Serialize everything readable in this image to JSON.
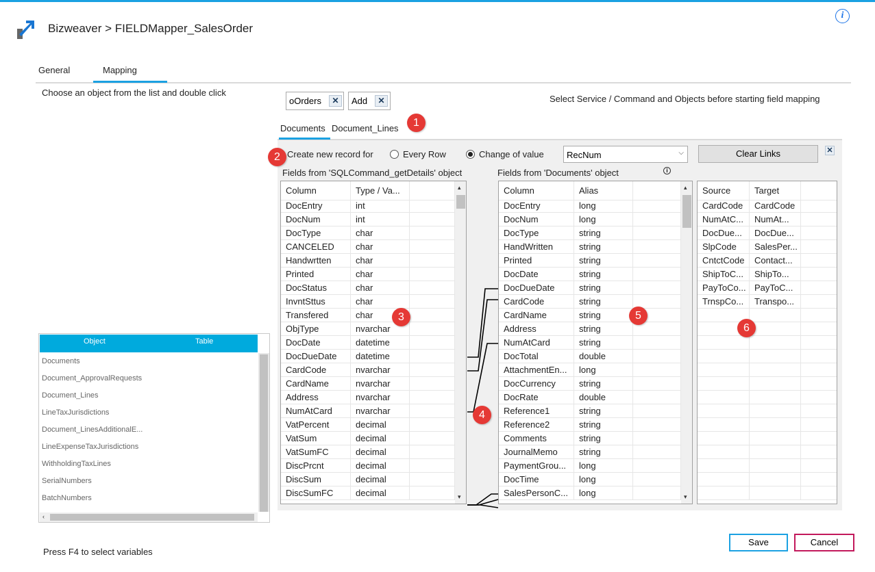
{
  "window": {
    "breadcrumb": "Bizweaver > FIELDMapper_SalesOrder",
    "info_glyph": "i"
  },
  "tabs": [
    {
      "label": "General"
    },
    {
      "label": "Mapping",
      "active": true
    }
  ],
  "left_panel": {
    "hint": "Choose an object from the list and double click",
    "object_table": {
      "headers": [
        "Object",
        "Table"
      ],
      "items": [
        "Documents",
        "Document_ApprovalRequests",
        "Document_Lines",
        "LineTaxJurisdictions",
        "Document_LinesAdditionalE...",
        "LineExpenseTaxJurisdictions",
        "WithholdingTaxLines",
        "SerialNumbers",
        "BatchNumbers"
      ]
    },
    "footer_hint": "Press F4 to select variables"
  },
  "chips": [
    {
      "label": "oOrders"
    },
    {
      "label": "Add"
    }
  ],
  "chip_remove_glyph": "✕",
  "select_hint": "Select Service / Command and Objects before starting field mapping",
  "subtabs": [
    {
      "label": "Documents",
      "active": true
    },
    {
      "label": "Document_Lines"
    }
  ],
  "badges": [
    "1",
    "2",
    "3",
    "4",
    "5",
    "6"
  ],
  "record_options": {
    "label": "Create new record for",
    "every_row": "Every Row",
    "change_of_value": "Change of value",
    "selected": "change_of_value",
    "field_value": "RecNum",
    "clear_links": "Clear Links",
    "close_glyph": "✕"
  },
  "source_grid": {
    "title": "Fields from 'SQLCommand_getDetails' object",
    "headers": [
      "Column",
      "Type / Va..."
    ],
    "rows": [
      [
        "DocEntry",
        "int"
      ],
      [
        "DocNum",
        "int"
      ],
      [
        "DocType",
        "char"
      ],
      [
        "CANCELED",
        "char"
      ],
      [
        "Handwrtten",
        "char"
      ],
      [
        "Printed",
        "char"
      ],
      [
        "DocStatus",
        "char"
      ],
      [
        "InvntSttus",
        "char"
      ],
      [
        "Transfered",
        "char"
      ],
      [
        "ObjType",
        "nvarchar"
      ],
      [
        "DocDate",
        "datetime"
      ],
      [
        "DocDueDate",
        "datetime"
      ],
      [
        "CardCode",
        "nvarchar"
      ],
      [
        "CardName",
        "nvarchar"
      ],
      [
        "Address",
        "nvarchar"
      ],
      [
        "NumAtCard",
        "nvarchar"
      ],
      [
        "VatPercent",
        "decimal"
      ],
      [
        "VatSum",
        "decimal"
      ],
      [
        "VatSumFC",
        "decimal"
      ],
      [
        "DiscPrcnt",
        "decimal"
      ],
      [
        "DiscSum",
        "decimal"
      ],
      [
        "DiscSumFC",
        "decimal"
      ]
    ]
  },
  "target_grid": {
    "title": "Fields from 'Documents' object",
    "info_glyph": "i",
    "headers": [
      "Column",
      "Alias"
    ],
    "rows": [
      [
        "DocEntry",
        "long"
      ],
      [
        "DocNum",
        "long"
      ],
      [
        "DocType",
        "string"
      ],
      [
        "HandWritten",
        "string"
      ],
      [
        "Printed",
        "string"
      ],
      [
        "DocDate",
        "string"
      ],
      [
        "DocDueDate",
        "string"
      ],
      [
        "CardCode",
        "string"
      ],
      [
        "CardName",
        "string"
      ],
      [
        "Address",
        "string"
      ],
      [
        "NumAtCard",
        "string"
      ],
      [
        "DocTotal",
        "double"
      ],
      [
        "AttachmentEn...",
        "long"
      ],
      [
        "DocCurrency",
        "string"
      ],
      [
        "DocRate",
        "double"
      ],
      [
        "Reference1",
        "string"
      ],
      [
        "Reference2",
        "string"
      ],
      [
        "Comments",
        "string"
      ],
      [
        "JournalMemo",
        "string"
      ],
      [
        "PaymentGrou...",
        "long"
      ],
      [
        "DocTime",
        "long"
      ],
      [
        "SalesPersonC...",
        "long"
      ]
    ]
  },
  "links_grid": {
    "headers": [
      "Source",
      "Target"
    ],
    "rows": [
      [
        "CardCode",
        "CardCode"
      ],
      [
        "NumAtC...",
        "NumAt..."
      ],
      [
        "DocDue...",
        "DocDue..."
      ],
      [
        "SlpCode",
        "SalesPer..."
      ],
      [
        "CntctCode",
        "Contact..."
      ],
      [
        "ShipToC...",
        "ShipTo..."
      ],
      [
        "PayToCo...",
        "PayToC..."
      ],
      [
        "TrnspCo...",
        "Transpo..."
      ]
    ]
  },
  "buttons": {
    "save": "Save",
    "cancel": "Cancel"
  }
}
